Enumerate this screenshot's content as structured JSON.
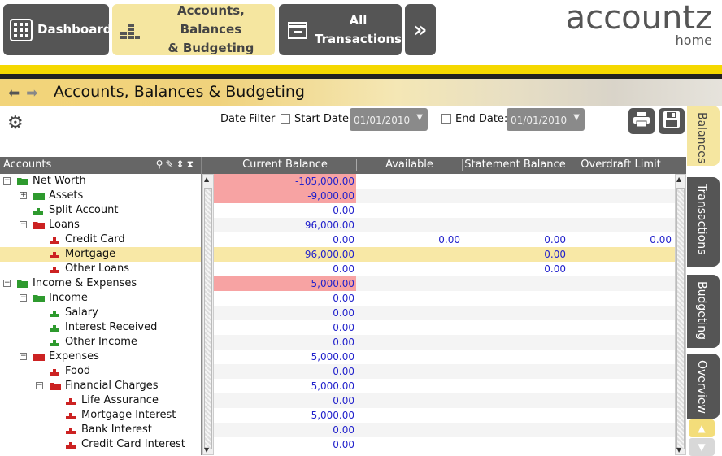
{
  "nav": {
    "buttons": [
      {
        "label": "Dashboard",
        "icon": "dashboard-grid-icon"
      },
      {
        "label": "Accounts, Balances & Budgeting",
        "line1": "Accounts, Balances",
        "line2": "& Budgeting",
        "icon": "coins-icon"
      },
      {
        "label": "All Transactions",
        "line1": "All",
        "line2": "Transactions",
        "icon": "inbox-tray-icon"
      }
    ],
    "more_icon": "double-chevron-right-icon"
  },
  "logo": {
    "name": "accountz",
    "sub": "home"
  },
  "page_title": "Accounts, Balances & Budgeting",
  "filters": {
    "label": "Date Filter",
    "start_label": "Start Date:",
    "start_value": "01/01/2010",
    "end_label": "End Date:",
    "end_value": "01/01/2010"
  },
  "tree": {
    "header": "Accounts",
    "rows": [
      {
        "label": "Net Worth",
        "level": 0,
        "type": "folder-green",
        "exp": "−"
      },
      {
        "label": "Assets",
        "level": 1,
        "type": "folder-green",
        "exp": "+"
      },
      {
        "label": "Split Account",
        "level": 1,
        "type": "acct-green",
        "exp": ""
      },
      {
        "label": "Loans",
        "level": 1,
        "type": "folder-red",
        "exp": "−"
      },
      {
        "label": "Credit Card",
        "level": 2,
        "type": "acct-red",
        "exp": ""
      },
      {
        "label": "Mortgage",
        "level": 2,
        "type": "acct-red",
        "exp": ""
      },
      {
        "label": "Other Loans",
        "level": 2,
        "type": "acct-red",
        "exp": ""
      },
      {
        "label": "Income & Expenses",
        "level": 0,
        "type": "folder-green",
        "exp": "−"
      },
      {
        "label": "Income",
        "level": 1,
        "type": "folder-green",
        "exp": "−"
      },
      {
        "label": "Salary",
        "level": 2,
        "type": "acct-green",
        "exp": ""
      },
      {
        "label": "Interest Received",
        "level": 2,
        "type": "acct-green",
        "exp": ""
      },
      {
        "label": "Other Income",
        "level": 2,
        "type": "acct-green",
        "exp": ""
      },
      {
        "label": "Expenses",
        "level": 1,
        "type": "folder-red",
        "exp": "−"
      },
      {
        "label": "Food",
        "level": 2,
        "type": "acct-red",
        "exp": ""
      },
      {
        "label": "Financial Charges",
        "level": 2,
        "type": "folder-red",
        "exp": "−"
      },
      {
        "label": "Life Assurance",
        "level": 3,
        "type": "acct-red",
        "exp": ""
      },
      {
        "label": "Mortgage Interest",
        "level": 3,
        "type": "acct-red",
        "exp": ""
      },
      {
        "label": "Bank Interest",
        "level": 3,
        "type": "acct-red",
        "exp": ""
      },
      {
        "label": "Credit Card Interest",
        "level": 3,
        "type": "acct-red",
        "exp": ""
      }
    ]
  },
  "grid": {
    "columns": [
      "Current Balance",
      "Available",
      "Statement Balance",
      "Overdraft Limit"
    ],
    "rows": [
      {
        "current": "-105,000.00",
        "neg": true,
        "available": "",
        "statement": "",
        "overdraft": ""
      },
      {
        "current": "-9,000.00",
        "neg": true,
        "available": "",
        "statement": "",
        "overdraft": ""
      },
      {
        "current": "0.00",
        "neg": false,
        "available": "",
        "statement": "",
        "overdraft": ""
      },
      {
        "current": "96,000.00",
        "neg": false,
        "available": "",
        "statement": "",
        "overdraft": ""
      },
      {
        "current": "0.00",
        "neg": false,
        "available": "0.00",
        "statement": "0.00",
        "overdraft": "0.00"
      },
      {
        "current": "96,000.00",
        "neg": false,
        "available": "",
        "statement": "0.00",
        "overdraft": ""
      },
      {
        "current": "0.00",
        "neg": false,
        "available": "",
        "statement": "0.00",
        "overdraft": ""
      },
      {
        "current": "-5,000.00",
        "neg": true,
        "available": "",
        "statement": "",
        "overdraft": ""
      },
      {
        "current": "0.00",
        "neg": false,
        "available": "",
        "statement": "",
        "overdraft": ""
      },
      {
        "current": "0.00",
        "neg": false,
        "available": "",
        "statement": "",
        "overdraft": ""
      },
      {
        "current": "0.00",
        "neg": false,
        "available": "",
        "statement": "",
        "overdraft": ""
      },
      {
        "current": "0.00",
        "neg": false,
        "available": "",
        "statement": "",
        "overdraft": ""
      },
      {
        "current": "5,000.00",
        "neg": false,
        "available": "",
        "statement": "",
        "overdraft": ""
      },
      {
        "current": "0.00",
        "neg": false,
        "available": "",
        "statement": "",
        "overdraft": ""
      },
      {
        "current": "5,000.00",
        "neg": false,
        "available": "",
        "statement": "",
        "overdraft": ""
      },
      {
        "current": "0.00",
        "neg": false,
        "available": "",
        "statement": "",
        "overdraft": ""
      },
      {
        "current": "5,000.00",
        "neg": false,
        "available": "",
        "statement": "",
        "overdraft": ""
      },
      {
        "current": "0.00",
        "neg": false,
        "available": "",
        "statement": "",
        "overdraft": ""
      },
      {
        "current": "0.00",
        "neg": false,
        "available": "",
        "statement": "",
        "overdraft": ""
      }
    ],
    "selected_row": 5
  },
  "side_tabs": [
    "Balances",
    "Transactions",
    "Budgeting",
    "Overview"
  ],
  "colors": {
    "accent_yellow": "#f5e6a0",
    "nav_dark": "#555555",
    "negative_bg": "#f7a3a3",
    "value_blue": "#2222cc",
    "folder_green": "#2e9a2e",
    "folder_red": "#cc2222"
  }
}
